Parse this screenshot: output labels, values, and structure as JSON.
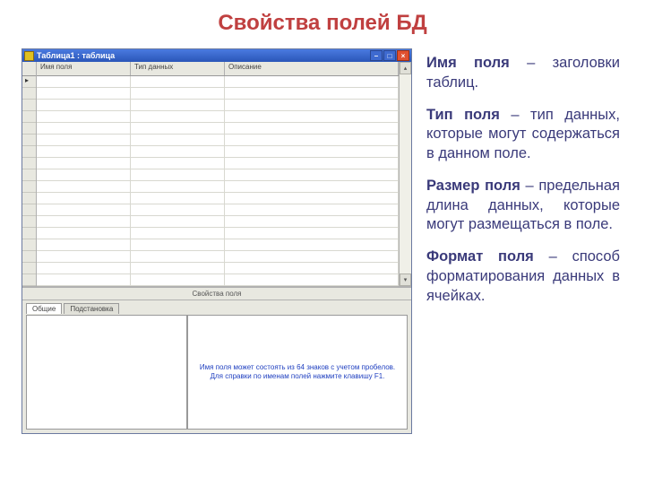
{
  "title": "Свойства полей БД",
  "window": {
    "title": "Таблица1 : таблица",
    "columns": {
      "c1": "Имя поля",
      "c2": "Тип данных",
      "c3": "Описание"
    },
    "props_label": "Свойства поля",
    "tab_general": "Общие",
    "tab_lookup": "Подстановка",
    "hint": "Имя поля может состоять из 64 знаков с учетом пробелов. Для справки по именам полей нажмите клавишу F1."
  },
  "definitions": [
    {
      "term": "Имя поля",
      "text": " – заголовки таблиц."
    },
    {
      "term": "Тип поля",
      "text": " – тип данных, которые могут содержаться в данном поле."
    },
    {
      "term": "Размер поля",
      "text": " – предельная длина данных, которые могут размещаться в поле."
    },
    {
      "term": "Формат поля",
      "text": " – способ форматирования данных в ячейках."
    }
  ]
}
